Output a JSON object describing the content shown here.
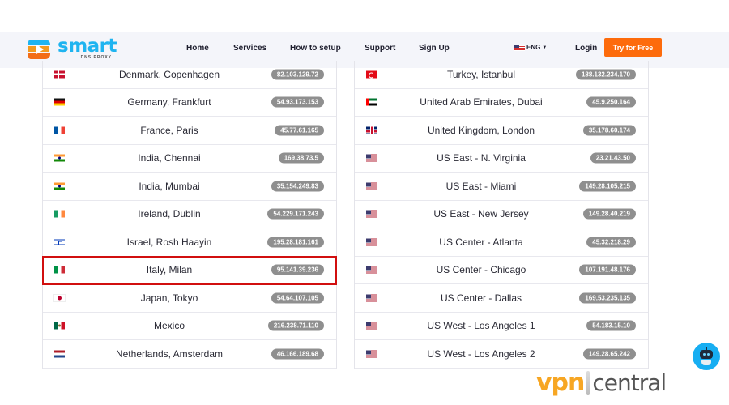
{
  "brand": {
    "name": "smart",
    "tagline": "DNS PROXY"
  },
  "nav": {
    "items": [
      "Home",
      "Services",
      "How to setup",
      "Support",
      "Sign Up"
    ],
    "language": "ENG",
    "login": "Login",
    "cta": "Try for Free"
  },
  "servers": {
    "left": [
      {
        "flag": "denmark-flag",
        "cls": "f-dk",
        "location": "Denmark, Copenhagen",
        "ip": "82.103.129.72"
      },
      {
        "flag": "germany-flag",
        "cls": "f-de",
        "location": "Germany, Frankfurt",
        "ip": "54.93.173.153"
      },
      {
        "flag": "france-flag",
        "cls": "f-fr",
        "location": "France, Paris",
        "ip": "45.77.61.165"
      },
      {
        "flag": "india-flag",
        "cls": "f-in",
        "location": "India, Chennai",
        "ip": "169.38.73.5"
      },
      {
        "flag": "india-flag",
        "cls": "f-in",
        "location": "India, Mumbai",
        "ip": "35.154.249.83"
      },
      {
        "flag": "ireland-flag",
        "cls": "f-ie",
        "location": "Ireland, Dublin",
        "ip": "54.229.171.243"
      },
      {
        "flag": "israel-flag",
        "cls": "f-il",
        "location": "Israel, Rosh Haayin",
        "ip": "195.28.181.161"
      },
      {
        "flag": "italy-flag",
        "cls": "f-it",
        "location": "Italy, Milan",
        "ip": "95.141.39.236",
        "highlighted": true
      },
      {
        "flag": "japan-flag",
        "cls": "f-jp",
        "location": "Japan, Tokyo",
        "ip": "54.64.107.105"
      },
      {
        "flag": "mexico-flag",
        "cls": "f-mx",
        "location": "Mexico",
        "ip": "216.238.71.110"
      },
      {
        "flag": "netherlands-flag",
        "cls": "f-nl",
        "location": "Netherlands, Amsterdam",
        "ip": "46.166.189.68"
      }
    ],
    "right": [
      {
        "flag": "turkey-flag",
        "cls": "f-tr",
        "location": "Turkey, Istanbul",
        "ip": "188.132.234.170"
      },
      {
        "flag": "uae-flag",
        "cls": "f-ae",
        "location": "United Arab Emirates, Dubai",
        "ip": "45.9.250.164"
      },
      {
        "flag": "uk-flag",
        "cls": "f-gb",
        "location": "United Kingdom, London",
        "ip": "35.178.60.174"
      },
      {
        "flag": "us-flag",
        "cls": "f-us",
        "location": "US East - N. Virginia",
        "ip": "23.21.43.50"
      },
      {
        "flag": "us-flag",
        "cls": "f-us",
        "location": "US East - Miami",
        "ip": "149.28.105.215"
      },
      {
        "flag": "us-flag",
        "cls": "f-us",
        "location": "US East - New Jersey",
        "ip": "149.28.40.219"
      },
      {
        "flag": "us-flag",
        "cls": "f-us",
        "location": "US Center - Atlanta",
        "ip": "45.32.218.29"
      },
      {
        "flag": "us-flag",
        "cls": "f-us",
        "location": "US Center - Chicago",
        "ip": "107.191.48.176"
      },
      {
        "flag": "us-flag",
        "cls": "f-us",
        "location": "US Center - Dallas",
        "ip": "169.53.235.135"
      },
      {
        "flag": "us-flag",
        "cls": "f-us",
        "location": "US West - Los Angeles 1",
        "ip": "54.183.15.10"
      },
      {
        "flag": "us-flag",
        "cls": "f-us",
        "location": "US West - Los Angeles 2",
        "ip": "149.28.65.242"
      }
    ]
  },
  "watermark": {
    "part1": "vpn",
    "part2": "central"
  },
  "colors": {
    "accent": "#fd6b0c",
    "brand": "#1fb4f0",
    "highlight": "#d10f0f",
    "ip_badge": "#8f8f8f"
  }
}
